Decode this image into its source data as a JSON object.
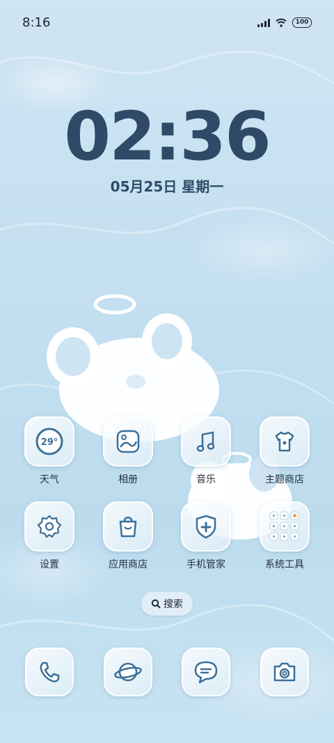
{
  "status_bar": {
    "time": "8:16",
    "battery": "100"
  },
  "lock_clock": {
    "time": "02:36",
    "date": "05月25日 星期一"
  },
  "apps": [
    {
      "label": "天气",
      "icon": "weather-icon",
      "temp": "29°"
    },
    {
      "label": "相册",
      "icon": "gallery-icon"
    },
    {
      "label": "音乐",
      "icon": "music-icon"
    },
    {
      "label": "主题商店",
      "icon": "theme-store-icon"
    },
    {
      "label": "设置",
      "icon": "settings-icon"
    },
    {
      "label": "应用商店",
      "icon": "app-store-icon"
    },
    {
      "label": "手机管家",
      "icon": "security-icon"
    },
    {
      "label": "系统工具",
      "icon": "system-tools-folder-icon"
    }
  ],
  "search": {
    "label": "搜索"
  },
  "dock": [
    {
      "icon": "phone-icon"
    },
    {
      "icon": "browser-icon"
    },
    {
      "icon": "messages-icon"
    },
    {
      "icon": "camera-icon"
    }
  ],
  "colors": {
    "icon_stroke": "#3a6f99",
    "clock": "#2e4a66"
  }
}
